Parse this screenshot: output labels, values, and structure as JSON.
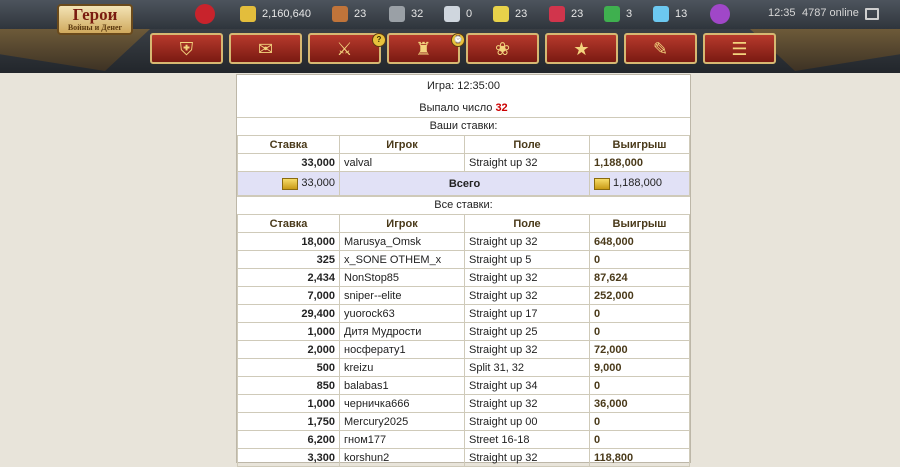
{
  "header": {
    "logo_line1": "Герои",
    "logo_line2": "Войны и Денег",
    "resources": [
      {
        "icon": "heart-icon",
        "value": "",
        "color": "#c8232c"
      },
      {
        "icon": "gold-icon",
        "value": "2,160,640",
        "color": "#e3bd3c"
      },
      {
        "icon": "wood-icon",
        "value": "23",
        "color": "#c0743a"
      },
      {
        "icon": "ore-icon",
        "value": "32",
        "color": "#9aa0a6"
      },
      {
        "icon": "mercury-icon",
        "value": "0",
        "color": "#cfd6de"
      },
      {
        "icon": "sulfur-icon",
        "value": "23",
        "color": "#e8d24a"
      },
      {
        "icon": "crystals-icon",
        "value": "23",
        "color": "#d1354c"
      },
      {
        "icon": "gems-icon",
        "value": "3",
        "color": "#3fb04f"
      },
      {
        "icon": "diamond-icon",
        "value": "13",
        "color": "#6cc8f0"
      },
      {
        "icon": "mana-orb-icon",
        "value": "",
        "color": "#a047c8"
      }
    ],
    "time": "12:35",
    "online": "4787 online"
  },
  "nav": [
    {
      "icon": "helmet-icon",
      "glyph": "⛨"
    },
    {
      "icon": "map-scroll-icon",
      "glyph": "✉"
    },
    {
      "icon": "crossed-swords-icon",
      "glyph": "⚔",
      "badge": "?"
    },
    {
      "icon": "tavern-icon",
      "glyph": "♜",
      "badge": "⌚"
    },
    {
      "icon": "cake-icon",
      "glyph": "❀"
    },
    {
      "icon": "stars-icon",
      "glyph": "★"
    },
    {
      "icon": "quill-icon",
      "glyph": "✎"
    },
    {
      "icon": "chat-icon",
      "glyph": "☰"
    }
  ],
  "game": {
    "title": "Игра: 12:35:00",
    "result_label": "Выпало число",
    "result_number": "32",
    "your_bets_title": "Ваши ставки:",
    "all_bets_title": "Все ставки:",
    "total_label": "Всего",
    "columns": [
      "Ставка",
      "Игрок",
      "Поле",
      "Выигрыш"
    ],
    "your_bets": [
      {
        "bet": "33,000",
        "player": "valval",
        "field": "Straight up 32",
        "win": "1,188,000"
      }
    ],
    "total": {
      "bet": "33,000",
      "win": "1,188,000"
    },
    "all_bets": [
      {
        "bet": "18,000",
        "player": "Marusya_Omsk",
        "field": "Straight up 32",
        "win": "648,000"
      },
      {
        "bet": "325",
        "player": "x_SONE OTHEM_x",
        "field": "Straight up 5",
        "win": "0"
      },
      {
        "bet": "2,434",
        "player": "NonStop85",
        "field": "Straight up 32",
        "win": "87,624"
      },
      {
        "bet": "7,000",
        "player": "sniper--elite",
        "field": "Straight up 32",
        "win": "252,000"
      },
      {
        "bet": "29,400",
        "player": "yuorock63",
        "field": "Straight up 17",
        "win": "0"
      },
      {
        "bet": "1,000",
        "player": "Дитя Мудрости",
        "field": "Straight up 25",
        "win": "0"
      },
      {
        "bet": "2,000",
        "player": "носферату1",
        "field": "Straight up 32",
        "win": "72,000"
      },
      {
        "bet": "500",
        "player": "kreizu",
        "field": "Split 31, 32",
        "win": "9,000"
      },
      {
        "bet": "850",
        "player": "balabas1",
        "field": "Straight up 34",
        "win": "0"
      },
      {
        "bet": "1,000",
        "player": "черничка666",
        "field": "Straight up 32",
        "win": "36,000"
      },
      {
        "bet": "1,750",
        "player": "Mercury2025",
        "field": "Straight up 00",
        "win": "0"
      },
      {
        "bet": "6,200",
        "player": "гном177",
        "field": "Street 16-18",
        "win": "0"
      },
      {
        "bet": "3,300",
        "player": "korshun2",
        "field": "Straight up 32",
        "win": "118,800"
      }
    ]
  }
}
